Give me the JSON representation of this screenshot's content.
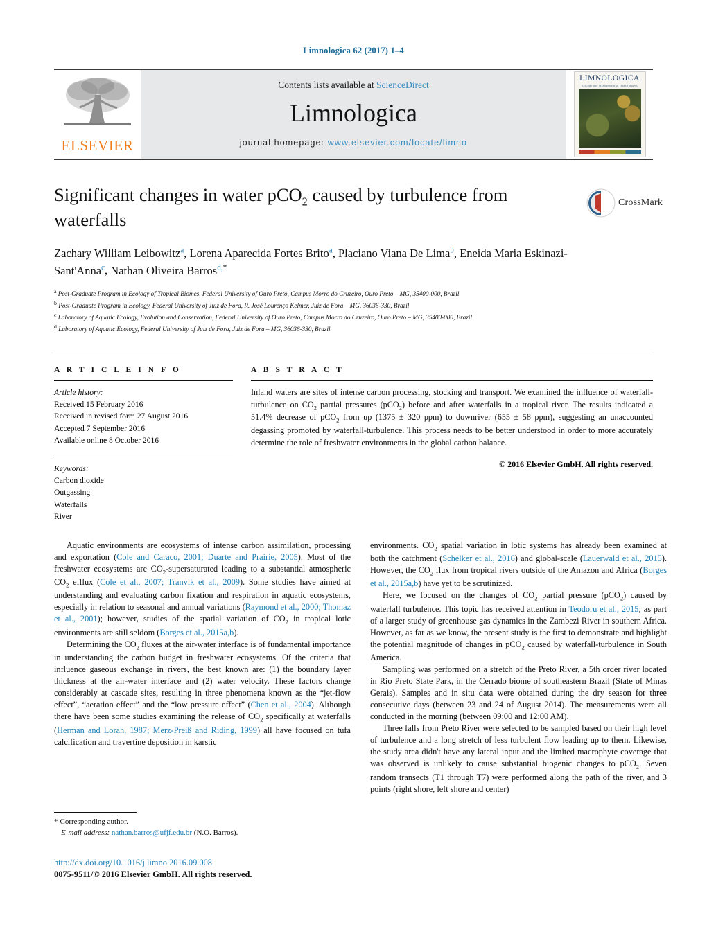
{
  "running_head": "Limnologica 62 (2017) 1–4",
  "masthead": {
    "publisher_name": "ELSEVIER",
    "contents_prefix": "Contents lists available at ",
    "contents_link": "ScienceDirect",
    "journal_title": "Limnologica",
    "homepage_prefix": "journal homepage: ",
    "homepage_url": "www.elsevier.com/locate/limno",
    "cover_title": "LIMNOLOGICA",
    "cover_subtitle": "Ecology and Management of Inland Waters"
  },
  "article": {
    "title_part1": "Significant changes in water pCO",
    "title_sub": "2",
    "title_part2": " caused by turbulence from waterfalls",
    "crossmark_label": "CrossMark",
    "authors": [
      {
        "name": "Zachary William Leibowitz",
        "marks": "a",
        "sep": ", "
      },
      {
        "name": "Lorena Aparecida Fortes Brito",
        "marks": "a",
        "sep": ", "
      },
      {
        "name": "Placiano Viana De Lima",
        "marks": "b",
        "sep": ", "
      },
      {
        "name": "Eneida Maria Eskinazi-Sant'Anna",
        "marks": "c",
        "sep": ", "
      },
      {
        "name": "Nathan Oliveira Barros",
        "marks": "d,",
        "star": "*",
        "sep": ""
      }
    ],
    "affiliations": [
      {
        "mark": "a",
        "text": "Post-Graduate Program in Ecology of Tropical Biomes, Federal University of Ouro Preto, Campus Morro do Cruzeiro, Ouro Preto – MG, 35400-000, Brazil"
      },
      {
        "mark": "b",
        "text": "Post-Graduate Program in Ecology, Federal University of Juiz de Fora, R. José Lourenço Kelmer, Juiz de Fora – MG, 36036-330, Brazil"
      },
      {
        "mark": "c",
        "text": "Laboratory of Aquatic Ecology, Evolution and Conservation, Federal University of Ouro Preto, Campus Morro do Cruzeiro, Ouro Preto – MG, 35400-000, Brazil"
      },
      {
        "mark": "d",
        "text": "Laboratory of Aquatic Ecology, Federal University of Juiz de Fora, Juiz de Fora – MG, 36036-330, Brazil"
      }
    ]
  },
  "article_info": {
    "heading": "A R T I C L E   I N F O",
    "history_title": "Article history:",
    "history": [
      "Received 15 February 2016",
      "Received in revised form 27 August 2016",
      "Accepted 7 September 2016",
      "Available online 8 October 2016"
    ],
    "keywords_title": "Keywords:",
    "keywords": [
      "Carbon dioxide",
      "Outgassing",
      "Waterfalls",
      "River"
    ]
  },
  "abstract": {
    "heading": "A B S T R A C T",
    "p1": "Inland waters are sites of intense carbon processing, stocking and transport. We examined the influence of waterfall-turbulence on CO",
    "p1b": " partial pressures (pCO",
    "p1c": ") before and after waterfalls in a tropical river. The results indicated a 51.4% decrease of pCO",
    "p1d": " from up (1375 ± 320 ppm) to downriver (655 ± 58 ppm), suggesting an unaccounted degassing promoted by waterfall-turbulence. This process needs to be better understood in order to more accurately determine the role of freshwater environments in the global carbon balance.",
    "copyright": "© 2016 Elsevier GmbH. All rights reserved."
  },
  "body": {
    "left": {
      "p1_a": "Aquatic environments are ecosystems of intense carbon assimilation, processing and exportation (",
      "p1_ref1": "Cole and Caraco, 2001; Duarte and Prairie, 2005",
      "p1_b": "). Most of the freshwater ecosystems are CO",
      "p1_c": "-supersaturated leading to a substantial atmospheric CO",
      "p1_d": " efflux (",
      "p1_ref2": "Cole et al., 2007; Tranvik et al., 2009",
      "p1_e": "). Some studies have aimed at understanding and evaluating carbon fixation and respiration in aquatic ecosystems, especially in relation to seasonal and annual variations (",
      "p1_ref3": "Raymond et al., 2000; Thomaz et al., 2001",
      "p1_f": "); however, studies of the spatial variation of CO",
      "p1_g": " in tropical lotic environments are still seldom (",
      "p1_ref4": "Borges et al., 2015a,b",
      "p1_h": ").",
      "p2_a": "Determining the CO",
      "p2_b": " fluxes at the air-water interface is of fundamental importance in understanding the carbon budget in freshwater ecosystems. Of the criteria that influence gaseous exchange in rivers, the best known are: (1) the boundary layer thickness at the air-water interface and (2) water velocity. These factors change considerably at cascade sites, resulting in three phenomena known as the “jet-flow effect”, “aeration effect” and the “low pressure effect” (",
      "p2_ref1": "Chen et al., 2004",
      "p2_c": "). Although there have been some studies examining the release of CO",
      "p2_d": " specifically at waterfalls (",
      "p2_ref2": "Herman and Lorah, 1987; Merz-Preiß and Riding, 1999",
      "p2_e": ") all have focused on tufa calcification and travertine deposition in karstic"
    },
    "right": {
      "p1_a": "environments. CO",
      "p1_b": " spatial variation in lotic systems has already been examined at both the catchment (",
      "p1_ref1": "Schelker et al., 2016",
      "p1_c": ") and global-scale (",
      "p1_ref2": "Lauerwald et al., 2015",
      "p1_d": "). However, the CO",
      "p1_e": " flux from tropical rivers outside of the Amazon and Africa (",
      "p1_ref3": "Borges et al., 2015a,b",
      "p1_f": ") have yet to be scrutinized.",
      "p2_a": "Here, we focused on the changes of CO",
      "p2_b": " partial pressure (pCO",
      "p2_c": ") caused by waterfall turbulence. This topic has received attention in ",
      "p2_ref1": "Teodoru et al., 2015",
      "p2_d": "; as part of a larger study of greenhouse gas dynamics in the Zambezi River in southern Africa. However, as far as we know, the present study is the first to demonstrate and highlight the potential magnitude of changes in pCO",
      "p2_e": " caused by waterfall-turbulence in South America.",
      "p3": "Sampling was performed on a stretch of the Preto River, a 5th order river located in Rio Preto State Park, in the Cerrado biome of southeastern Brazil (State of Minas Gerais). Samples and in situ data were obtained during the dry season for three consecutive days (between 23 and 24 of August 2014). The measurements were all conducted in the morning (between 09:00 and 12:00 AM).",
      "p4_a": "Three falls from Preto River were selected to be sampled based on their high level of turbulence and a long stretch of less turbulent flow leading up to them. Likewise, the study area didn't have any lateral input and the limited macrophyte coverage that was observed is unlikely to cause substantial biogenic changes to pCO",
      "p4_b": ". Seven random transects (T1 through T7) were performed along the path of the river, and 3 points (right shore, left shore and center)"
    }
  },
  "footnote": {
    "star": "*",
    "corresponding": "Corresponding author.",
    "email_label": "E-mail address:",
    "email": "nathan.barros@ufjf.edu.br",
    "email_suffix": "(N.O. Barros)."
  },
  "footer": {
    "doi": "http://dx.doi.org/10.1016/j.limno.2016.09.008",
    "issn": "0075-9511/© 2016 Elsevier GmbH. All rights reserved."
  },
  "colors": {
    "link": "#1b7fb5",
    "elsevier_orange": "#f07c1a",
    "masthead_bg": "#e7e8e9"
  }
}
